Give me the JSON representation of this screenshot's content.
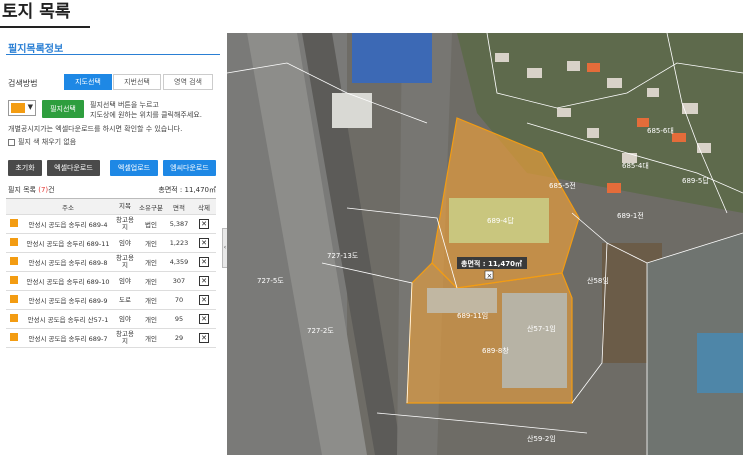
{
  "page": {
    "title": "토지 목록"
  },
  "panel": {
    "title": "필지목록정보",
    "select_method_label": "검색방법",
    "tabs": [
      {
        "label": "지도선택",
        "active": true
      },
      {
        "label": "지번선택",
        "active": false
      },
      {
        "label": "영역 검색",
        "active": false
      }
    ],
    "color": "#f39c12",
    "select_button": "필지선택",
    "hint_line1": "필지선택 버튼을 누르고",
    "hint_line2": "지도상에 원하는 위치를 클릭해주세요.",
    "note": "개별공시지가는 엑셀다운로드를 하시면 확인할 수 있습니다.",
    "fill_checkbox": "필지 색 채우기 없음",
    "buttons": {
      "reset": "초기화",
      "excel_download": "엑셀다운로드",
      "excel_upload": "엑셀업로드",
      "kml_download": "엠씨다운로드"
    },
    "list_label": "필지 목록",
    "list_count": "(7)",
    "list_count_unit": "건",
    "total_area": "총면적 : 11,470㎡"
  },
  "table": {
    "headers": [
      "주소",
      "지목",
      "소유구분",
      "면적",
      "삭제"
    ],
    "rows": [
      {
        "address": "안성시 공도읍 송두리 689-4",
        "jimok": "창고용지",
        "owner": "법인",
        "area": "5,387"
      },
      {
        "address": "안성시 공도읍 송두리 689-11",
        "jimok": "임야",
        "owner": "개인",
        "area": "1,223"
      },
      {
        "address": "안성시 공도읍 송두리 689-8",
        "jimok": "창고용지",
        "owner": "개인",
        "area": "4,359"
      },
      {
        "address": "안성시 공도읍 송두리 689-10",
        "jimok": "임야",
        "owner": "개인",
        "area": "307"
      },
      {
        "address": "안성시 공도읍 송두리 689-9",
        "jimok": "도로",
        "owner": "개인",
        "area": "70"
      },
      {
        "address": "안성시 공도읍 송두리 산57-1",
        "jimok": "임야",
        "owner": "개인",
        "area": "95"
      },
      {
        "address": "안성시 공도읍 송두리 689-7",
        "jimok": "창고용지",
        "owner": "개인",
        "area": "29"
      }
    ]
  },
  "map": {
    "total_area_label": "총면적 : 11,470㎡",
    "parcel_labels": [
      "689-4답",
      "689-11임",
      "689-8창",
      "727-5도",
      "685-5전",
      "689-1전",
      "685-4대",
      "산57-1임",
      "727-13도",
      "산59-2임",
      "685-6대",
      "727-2도",
      "산58임",
      "689-5답"
    ]
  }
}
